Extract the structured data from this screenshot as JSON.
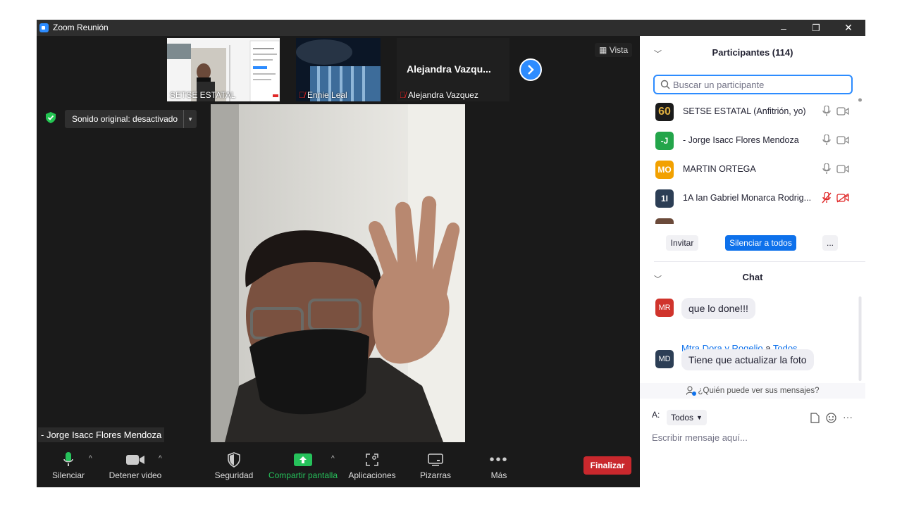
{
  "window": {
    "title": "Zoom Reunión",
    "controls": [
      "–",
      "❐",
      "✕"
    ]
  },
  "video_strip": {
    "thumbnails": [
      {
        "label": "SETSE ESTATAL",
        "muted": false
      },
      {
        "label": "Ennie Leal",
        "muted": true
      },
      {
        "name_overlay": "Alejandra  Vazqu...",
        "label": "Alejandra Vazquez",
        "muted": true
      }
    ],
    "next_icon": "chevron-right",
    "view_label": "Vista"
  },
  "main_video": {
    "sound_pill": "Sonido original: desactivado",
    "speaker_name": "- Jorge Isacc Flores Mendoza"
  },
  "toolbar": {
    "mute": "Silenciar",
    "video": "Detener video",
    "security": "Seguridad",
    "share": "Compartir pantalla",
    "apps": "Aplicaciones",
    "whiteboards": "Pizarras",
    "more": "Más",
    "end": "Finalizar"
  },
  "participants": {
    "header": "Participantes (114)",
    "search_placeholder": "Buscar un participante",
    "list": [
      {
        "initials": "60",
        "name": "SETSE ESTATAL (Anfitrión, yo)",
        "color": "#1b1b1b",
        "muted": false
      },
      {
        "initials": "-J",
        "name": "- Jorge Isacc Flores Mendoza",
        "color": "#23a54a",
        "muted": false
      },
      {
        "initials": "MO",
        "name": "MARTIN ORTEGA",
        "color": "#f2a100",
        "muted": false
      },
      {
        "initials": "1I",
        "name": "1A Ian Gabriel Monarca Rodrig...",
        "color": "#2c3e55",
        "muted": true
      }
    ],
    "invite": "Invitar",
    "mute_all": "Silenciar a todos",
    "more": "..."
  },
  "chat": {
    "header": "Chat",
    "messages": [
      {
        "initials": "MR",
        "color": "#d0342c",
        "text": "que lo done!!!"
      },
      {
        "initials": "MD",
        "color": "#2c3e55",
        "from": "Mtra Dora y Rogelio",
        "to_word": "a",
        "to": "Todos",
        "text": "Tiene que actualizar la foto"
      }
    ],
    "who_sees": "¿Quién puede ver sus mensajes?",
    "to_label": "A:",
    "to_value": "Todos",
    "input_placeholder": "Escribir mensaje aquí...",
    "more": "···"
  },
  "colors": {
    "accent": "#2d8cff",
    "end_red": "#c9282d",
    "share_green": "#26c25b"
  }
}
